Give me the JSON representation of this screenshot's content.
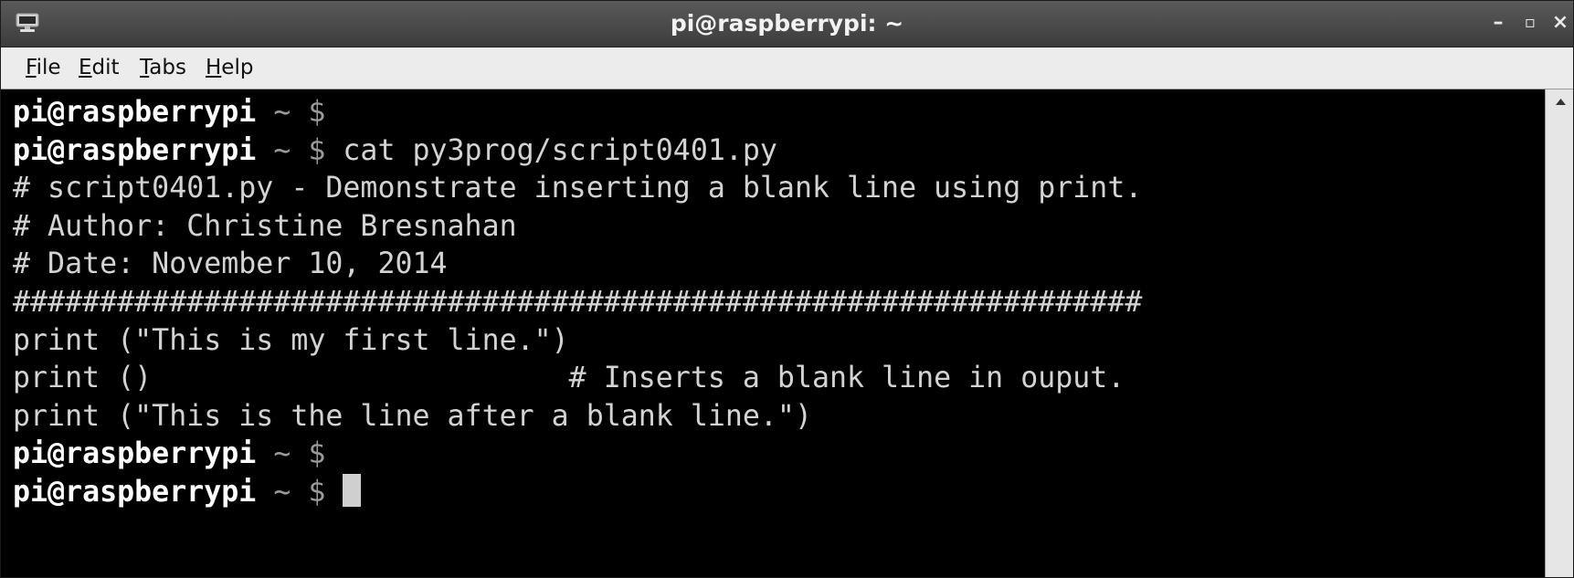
{
  "window": {
    "title": "pi@raspberrypi: ~",
    "controls": {
      "minimize": "–",
      "maximize": "▫",
      "close": "×"
    }
  },
  "menubar": {
    "items": [
      {
        "mnemonic": "F",
        "rest": "ile"
      },
      {
        "mnemonic": "E",
        "rest": "dit"
      },
      {
        "mnemonic": "T",
        "rest": "abs"
      },
      {
        "mnemonic": "H",
        "rest": "elp"
      }
    ]
  },
  "terminal": {
    "prompt_user": "pi@raspberrypi",
    "prompt_tail": " ~ $",
    "lines": [
      {
        "kind": "prompt",
        "cmd": ""
      },
      {
        "kind": "prompt",
        "cmd": " cat py3prog/script0401.py"
      },
      {
        "kind": "output",
        "text": "# script0401.py - Demonstrate inserting a blank line using print."
      },
      {
        "kind": "output",
        "text": "# Author: Christine Bresnahan"
      },
      {
        "kind": "output",
        "text": "# Date: November 10, 2014"
      },
      {
        "kind": "output",
        "text": "#################################################################"
      },
      {
        "kind": "output",
        "text": "print (\"This is my first line.\")"
      },
      {
        "kind": "output",
        "text": "print ()                        # Inserts a blank line in ouput."
      },
      {
        "kind": "output",
        "text": "print (\"This is the line after a blank line.\")"
      },
      {
        "kind": "prompt",
        "cmd": ""
      },
      {
        "kind": "prompt",
        "cmd": " ",
        "cursor": true
      }
    ]
  },
  "colors": {
    "terminal_bg": "#000000",
    "terminal_fg": "#d3d3d3",
    "prompt_user": "#ffffff",
    "prompt_tail": "#9a9a9a",
    "titlebar": "#4a4a4a",
    "menubar": "#ececec"
  },
  "icons": {
    "app": "terminal-app-icon",
    "scroll_up": "scroll-up-arrow-icon"
  }
}
